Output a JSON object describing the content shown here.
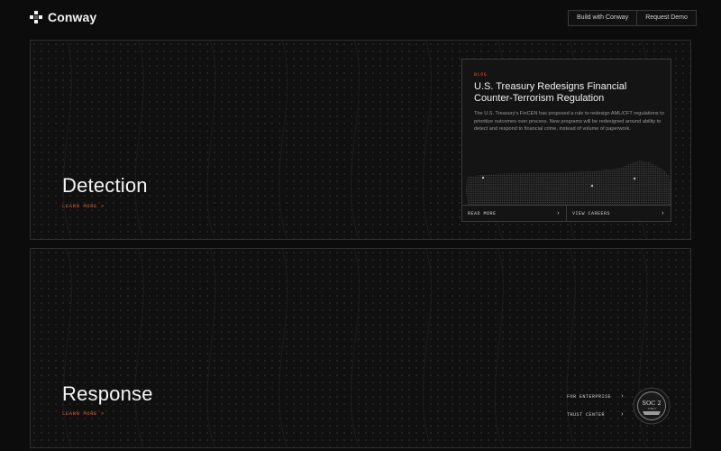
{
  "header": {
    "brand": "Conway",
    "actions": [
      "Build with Conway",
      "Request Demo"
    ]
  },
  "detection": {
    "title": "Detection",
    "cta": "LEARN MORE >"
  },
  "blog": {
    "tag": "BLOG",
    "title": "U.S. Treasury Redesigns Financial Counter-Terrorism Regulation",
    "body": "The U.S. Treasury's FinCEN has proposed a rule to redesign AML/CFT regulations to prioritize outcomes over process. New programs will be redesigned around ability to detect and respond to financial crime, instead of volume of paperwork.",
    "read_more": "READ MORE",
    "view_careers": "VIEW CAREERS"
  },
  "response": {
    "title": "Response",
    "cta": "LEARN MORE >",
    "links": [
      "FOR ENTERPRISE",
      "TRUST CENTER"
    ]
  },
  "badge": {
    "line1": "SOC 2",
    "line2": "TYPE II"
  },
  "colors": {
    "background": "#0c0c0c",
    "accent": "#e0602b",
    "border": "#3a3a3a"
  },
  "icons": [
    "conway-logo-icon",
    "chevron-right-icon",
    "soc2-badge-icon",
    "map-icon"
  ]
}
